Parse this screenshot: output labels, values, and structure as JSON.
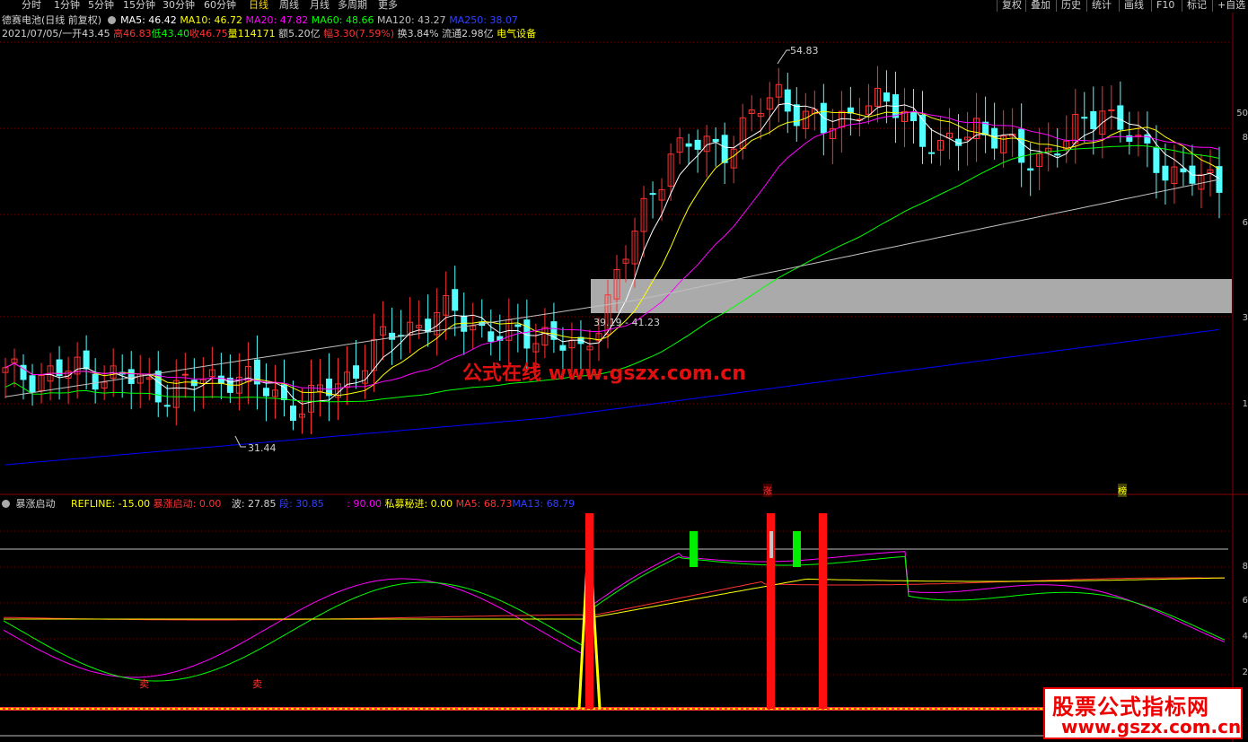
{
  "toolbar": {
    "periods": [
      "分时",
      "1分钟",
      "5分钟",
      "15分钟",
      "30分钟",
      "60分钟",
      "日线",
      "周线",
      "月线",
      "多周期",
      "更多"
    ],
    "active_period": "日线",
    "right_buttons": [
      "复权",
      "叠加",
      "历史",
      "统计",
      "画线",
      "F10",
      "标记",
      "+自选"
    ]
  },
  "header": {
    "stock": "德赛电池(日线 前复权)",
    "ma5": "MA5: 46.42",
    "ma10": "MA10: 46.72",
    "ma20": "MA20: 47.82",
    "ma60": "MA60: 48.66",
    "ma120": "MA120: 43.27",
    "ma250": "MA250: 38.07",
    "date": "2021/07/05/一",
    "open": "开43.45",
    "high": "高46.83",
    "low": "低43.40",
    "close": "收46.75",
    "volume": "量114171",
    "amount": "额5.20亿",
    "range": "幅3.30(7.59%)",
    "turnover": "换3.84%",
    "float": "流通2.98亿",
    "sector": "电气设备"
  },
  "main_chart": {
    "high_label": "54.83",
    "low_label": "31.44",
    "zone_label": "39.19 - 41.23",
    "marker_zhang": "涨",
    "marker_bang": "榜",
    "axis_labels": [
      "50",
      "8",
      "6",
      "3",
      "1"
    ]
  },
  "indicator": {
    "name": "暴涨启动",
    "refline": "REFLINE: -15.00",
    "baozhang": "暴涨启动: 0.00",
    "bo": "波: 27.85",
    "duan": "段: 30.85",
    "v90": ": 90.00",
    "simu": "私募秘进: 0.00",
    "ma5": "MA5: 68.73",
    "ma13": "MA13: 68.79",
    "sell_label": "卖",
    "axis_labels": [
      "8",
      "6",
      "4",
      "2"
    ]
  },
  "watermarks": {
    "center": "公式在线 www.gszx.com.cn",
    "corner_line1": "股票公式指标网",
    "corner_line2": "www.gszx.com.cn"
  },
  "colors": {
    "up": "#ff3232",
    "down": "#54ffff",
    "ma5": "#ffffff",
    "ma10": "#ffff00",
    "ma20": "#ff00ff",
    "ma60": "#00ff00",
    "ma120": "#c0c0c0",
    "ma250": "#0000ff"
  }
}
